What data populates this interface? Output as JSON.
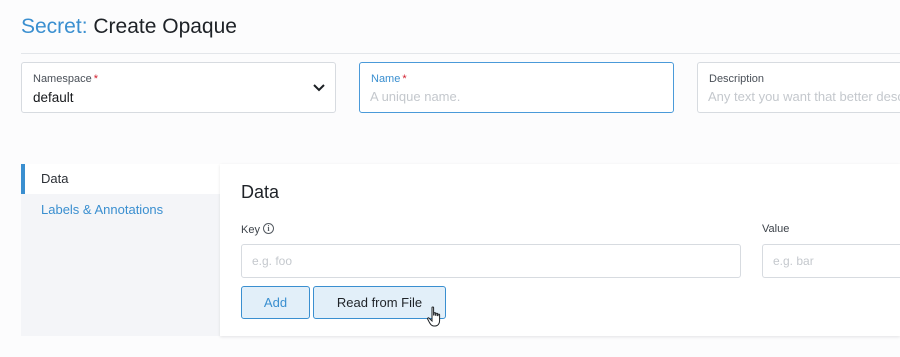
{
  "header": {
    "type_label": "Secret:",
    "title": "Create Opaque"
  },
  "fields": {
    "namespace": {
      "label": "Namespace",
      "required_mark": "*",
      "value": "default"
    },
    "name": {
      "label": "Name",
      "required_mark": "*",
      "placeholder": "A unique name."
    },
    "description": {
      "label": "Description",
      "placeholder": "Any text you want that better describes this resource"
    }
  },
  "tabs": [
    {
      "label": "Data",
      "active": true
    },
    {
      "label": "Labels & Annotations",
      "active": false
    }
  ],
  "data_section": {
    "title": "Data",
    "key_label": "Key",
    "key_info_icon": "info-icon",
    "value_label": "Value",
    "key_placeholder": "e.g. foo",
    "value_placeholder": "e.g. bar",
    "add_button": "Add",
    "read_file_button": "Read from File"
  },
  "colors": {
    "accent": "#3a8fd0",
    "required": "#d2202f"
  }
}
